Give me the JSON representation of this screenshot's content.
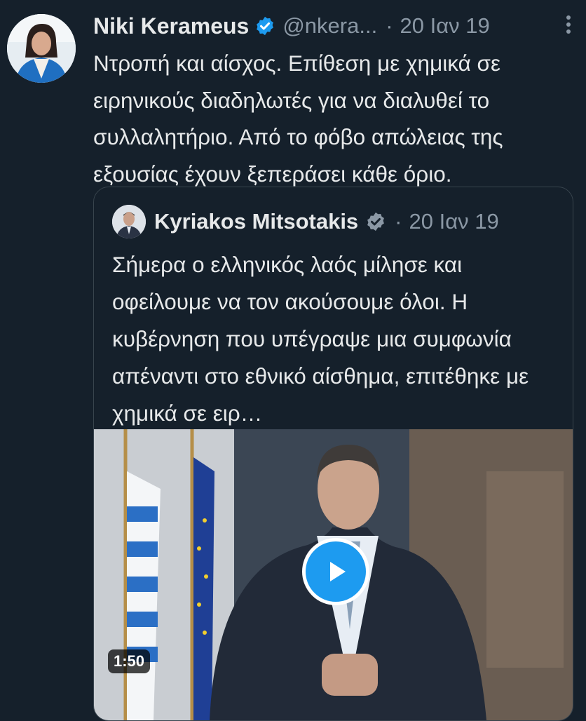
{
  "tweet": {
    "author_name": "Niki Kerameus",
    "handle": "@nkera...",
    "separator": "·",
    "date": "20 Ιαν 19",
    "text": "Ντροπή και αίσχος. Επίθεση με χημικά σε ειρηνικούς διαδηλωτές για να διαλυθεί το συλλαλητήριο. Από το φόβο απώλειας της εξουσίας έχουν ξεπεράσει κάθε όριο."
  },
  "quote": {
    "author_name": "Kyriakos Mitsotakis",
    "separator": "·",
    "date": "20 Ιαν 19",
    "text": "Σήμερα ο ελληνικός λαός μίλησε και οφείλουμε να τον ακούσουμε όλοι. Η κυβέρνηση που υπέγραψε μια συμφωνία απέναντι στο εθνικό αίσθημα, επιτέθηκε με χημικά σε ειρ…",
    "video_duration": "1:50"
  },
  "colors": {
    "background": "#15202b",
    "text_primary": "#e7e9ea",
    "text_secondary": "#8b98a5",
    "accent": "#1d9bf0",
    "border": "#38444d"
  },
  "icons": {
    "verified": "verified-badge-icon",
    "more": "more-vertical-icon",
    "play": "play-icon"
  }
}
